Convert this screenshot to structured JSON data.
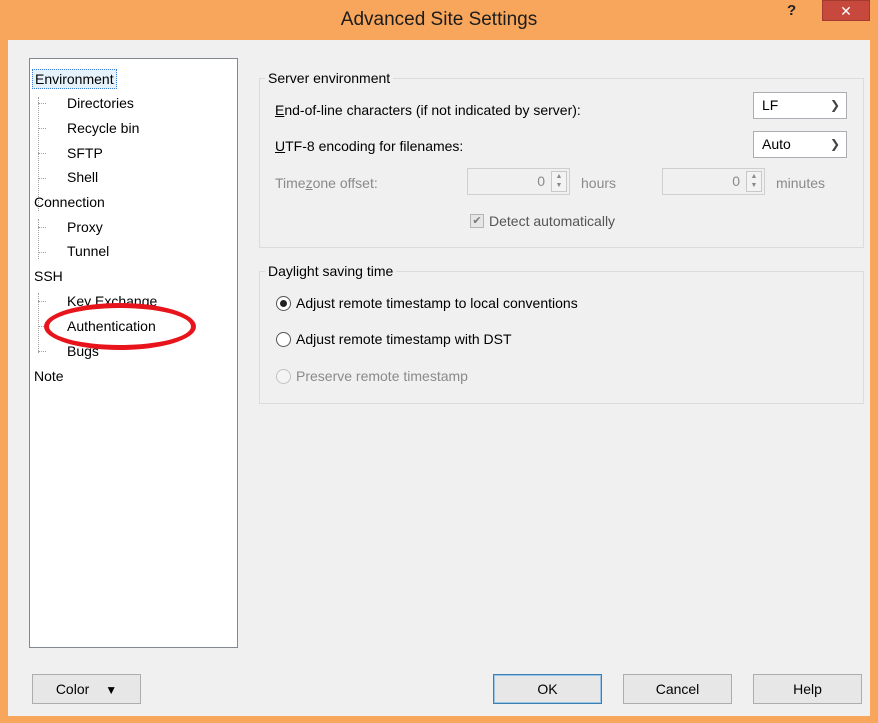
{
  "window": {
    "title": "Advanced Site Settings",
    "help_glyph": "?",
    "close_glyph": "✕"
  },
  "tree": {
    "items": [
      {
        "label": "Environment",
        "level": 0,
        "selected": true
      },
      {
        "label": "Directories",
        "level": 1
      },
      {
        "label": "Recycle bin",
        "level": 1
      },
      {
        "label": "SFTP",
        "level": 1
      },
      {
        "label": "Shell",
        "level": 1
      },
      {
        "label": "Connection",
        "level": 0
      },
      {
        "label": "Proxy",
        "level": 1
      },
      {
        "label": "Tunnel",
        "level": 1
      },
      {
        "label": "SSH",
        "level": 0
      },
      {
        "label": "Key Exchange",
        "level": 1
      },
      {
        "label": "Authentication",
        "level": 1,
        "highlighted": true
      },
      {
        "label": "Bugs",
        "level": 1
      },
      {
        "label": "Note",
        "level": 0
      }
    ]
  },
  "server_env": {
    "title": "Server environment",
    "eol_label_u": "E",
    "eol_label_rest": "nd-of-line characters (if not indicated by server):",
    "eol_value": "LF",
    "utf8_label_u": "U",
    "utf8_label_rest": "TF-8 encoding for filenames:",
    "utf8_value": "Auto",
    "tz_label_pre": "Time",
    "tz_label_u": "z",
    "tz_label_post": "one offset:",
    "tz_hours_value": "0",
    "tz_hours_unit": "hours",
    "tz_minutes_value": "0",
    "tz_minutes_unit": "minutes",
    "detect_label": "Detect automatically",
    "detect_checked": true
  },
  "dst": {
    "title": "Daylight saving time",
    "options": [
      {
        "label": "Adjust remote timestamp to local conventions",
        "checked": true,
        "enabled": true
      },
      {
        "label": "Adjust remote timestamp with DST",
        "checked": false,
        "enabled": true
      },
      {
        "label": "Preserve remote timestamp",
        "checked": false,
        "enabled": false
      }
    ]
  },
  "buttons": {
    "color": "Color",
    "ok": "OK",
    "cancel": "Cancel",
    "help": "Help"
  },
  "icons": {
    "dropdown": "chevron-down-icon",
    "spin": "spin-arrows-icon",
    "check": "checkmark-icon",
    "color_dropdown": "triangle-down-icon"
  },
  "colors": {
    "title_bar": "#f7a65c",
    "close_button": "#c7483c",
    "annotation_ellipse": "#e8141b"
  }
}
